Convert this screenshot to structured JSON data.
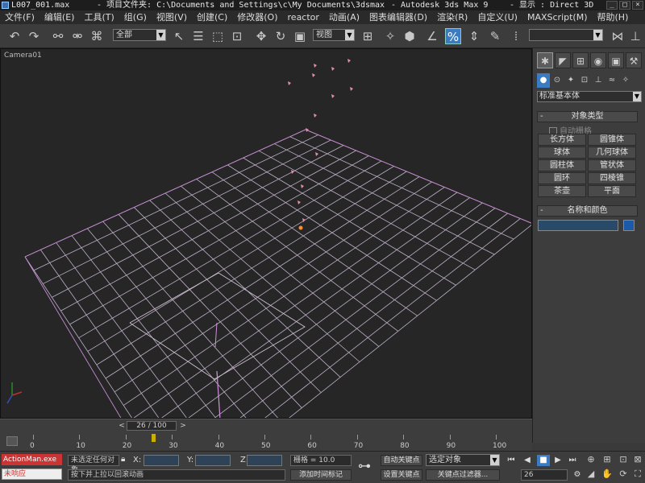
{
  "title": {
    "file": "L007_001.max",
    "project": "- 项目文件夹: C:\\Documents and Settings\\c\\My Documents\\3dsmax",
    "app": "- Autodesk 3ds Max 9",
    "display": "- 显示 : Direct 3D",
    "controls": [
      "_",
      "□",
      "×"
    ]
  },
  "menu": [
    "文件(F)",
    "编辑(E)",
    "工具(T)",
    "组(G)",
    "视图(V)",
    "创建(C)",
    "修改器(O)",
    "reactor",
    "动画(A)",
    "图表编辑器(D)",
    "渲染(R)",
    "自定义(U)",
    "MAXScript(M)",
    "帮助(H)"
  ],
  "toolbar": {
    "selection_filter": "全部",
    "ref_coord": "视图",
    "named_selection": "",
    "icons": [
      "undo-icon",
      "redo-icon",
      "link-icon",
      "unlink-icon",
      "bind-icon",
      "select-icon",
      "select-name-icon",
      "rect-select-icon",
      "window-cross-icon",
      "move-icon",
      "rotate-icon",
      "scale-icon",
      "pivot-icon",
      "manipulate-icon",
      "snap-icon",
      "angle-snap-icon",
      "percent-snap-icon",
      "spinner-snap-icon",
      "named-sets-icon",
      "mirror-icon",
      "align-icon"
    ]
  },
  "viewport": {
    "label": "Camera01"
  },
  "command_panel": {
    "tabs": [
      "create",
      "modify",
      "hierarchy",
      "motion",
      "display",
      "utilities"
    ],
    "subtabs": [
      "geometry",
      "shapes",
      "lights",
      "cameras",
      "helpers",
      "space-warps",
      "systems"
    ],
    "category": "标准基本体",
    "object_type_title": "对象类型",
    "autogrid": "自动栅格",
    "buttons": [
      "长方体",
      "圆锥体",
      "球体",
      "几何球体",
      "圆柱体",
      "管状体",
      "圆环",
      "四棱锥",
      "茶壶",
      "平面"
    ],
    "name_color_title": "名称和颜色"
  },
  "timeline": {
    "current": "26 / 100",
    "ticks": [
      0,
      10,
      20,
      30,
      40,
      50,
      60,
      70,
      80,
      90,
      100
    ],
    "key_frames": [
      26
    ]
  },
  "status": {
    "script_line1": "ActionMan.exe",
    "script_line2": "未响应",
    "selection": "未选定任何对象",
    "prompt": "按下并上拉以回滚动画",
    "x_label": "X:",
    "y_label": "Y:",
    "z_label": "Z:",
    "grid": "栅格 = 10.0",
    "add_time_tag": "添加时间标记",
    "auto_key": "自动关键点",
    "set_key": "设置关键点",
    "selected": "选定对象",
    "key_filters": "关键点过滤器...",
    "frame": "26"
  }
}
